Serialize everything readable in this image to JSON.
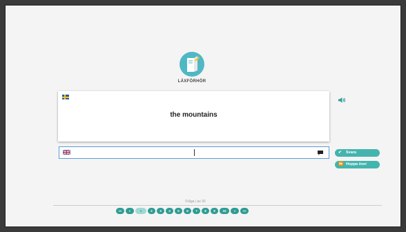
{
  "app": {
    "title": "LÄXFÖRHÖR"
  },
  "question": {
    "text": "the mountains",
    "source_flag": "swedish-flag-icon"
  },
  "answer": {
    "value": "",
    "placeholder": "",
    "target_flag": "uk-flag-icon"
  },
  "actions": {
    "submit_label": "Svara",
    "skip_label": "Hoppa över"
  },
  "progress": {
    "counter_text": "Fråga | av 30",
    "current_page": 1
  },
  "pager": {
    "first_label": "««",
    "prev_label": "«",
    "pages": [
      "1",
      "2",
      "3",
      "4",
      "5",
      "6",
      "7",
      "8",
      "9",
      "10"
    ],
    "next_label": "»",
    "last_label": "»»"
  },
  "colors": {
    "accent": "#43b4ae",
    "logo": "#4fb8c4",
    "pager": "#2f9c93",
    "input_border": "#5b9bd5"
  }
}
